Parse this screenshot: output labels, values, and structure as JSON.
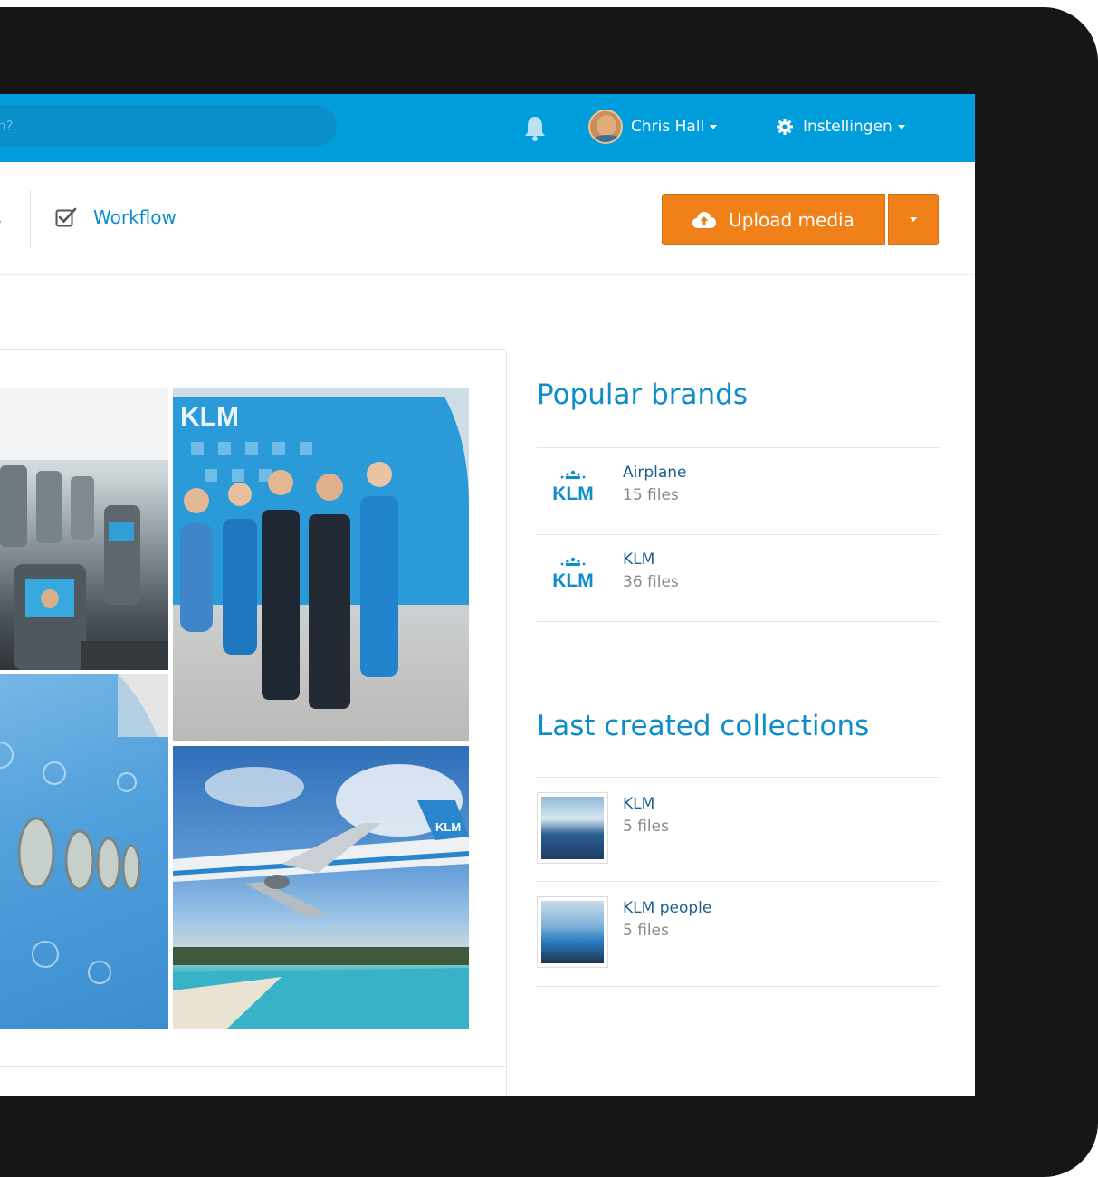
{
  "topbar": {
    "search_placeholder": "ts zoeken?",
    "user_name": "Chris Hall",
    "settings_label": "Instellingen"
  },
  "subnav": {
    "guidelines_label": "delines",
    "workflow_label": "Workflow",
    "upload_label": "Upload media"
  },
  "popular_brands": {
    "heading": "Popular brands",
    "items": [
      {
        "logo_text": "KLM",
        "title": "Airplane",
        "count": "15 files"
      },
      {
        "logo_text": "KLM",
        "title": "KLM",
        "count": "36 files"
      }
    ]
  },
  "collections": {
    "heading": "Last created collections",
    "items": [
      {
        "title": "KLM",
        "count": "5 files"
      },
      {
        "title": "KLM people",
        "count": "5 files"
      }
    ]
  },
  "photos": {
    "crew_plane_text": "KLM",
    "landing_tail_text": "KLM"
  },
  "colors": {
    "brand_blue": "#009ddd",
    "link_blue": "#0e8ccc",
    "upload_orange": "#f08018",
    "frame": "#161616"
  }
}
